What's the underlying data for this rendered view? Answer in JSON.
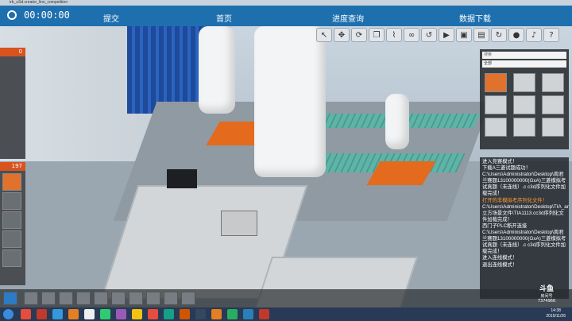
{
  "window": {
    "title": "irb_uSd.creator_line_competition"
  },
  "header": {
    "timer": "00:00:00",
    "nav": {
      "submit": "提交",
      "home": "首页",
      "progress": "进度查询",
      "download": "数据下载"
    }
  },
  "library": {
    "search_placeholder": "搜索",
    "category": "全部"
  },
  "left_panel": {
    "count_top": "0",
    "count_parts": "197"
  },
  "log_lines": [
    {
      "text": "进入竞赛模式！",
      "highlight": false
    },
    {
      "text": "下载A三菱试题成功！",
      "highlight": false
    },
    {
      "text": "C:\\Users\\Administrator\\Desktop\\周君兰赛题13100000000(GxA)三菱模拟考试真题（未连线）.c c3d序列化文件加载完成！",
      "highlight": false
    },
    {
      "text": "打开的非模拟考序列化文件！",
      "highlight": true
    },
    {
      "text": "C:\\Users\\Administrator\\Desktop\\TIA_and_GX_eg\\简立方场景文件\\TIA1113.cc3d序列化文件加载完成！",
      "highlight": false
    },
    {
      "text": "西门子PLC断开连接",
      "highlight": false
    },
    {
      "text": "C:\\Users\\Administrator\\Desktop\\周君兰赛题13100000000(GxA)三菱模拟考试真题（未连线）.c c3d序列化文件加载完成！",
      "highlight": false
    },
    {
      "text": "进入连线模式！",
      "highlight": false
    },
    {
      "text": "退出连线模式！",
      "highlight": false
    }
  ],
  "watermark": {
    "brand": "斗鱼",
    "line1": "房间号",
    "line2": "7374966"
  },
  "taskbar": {
    "time": "14:38",
    "date": "2019/11/26"
  },
  "colors": {
    "topbar": "#1e6fae",
    "badge": "#d9531e",
    "highlight": "#ff9a2e"
  }
}
